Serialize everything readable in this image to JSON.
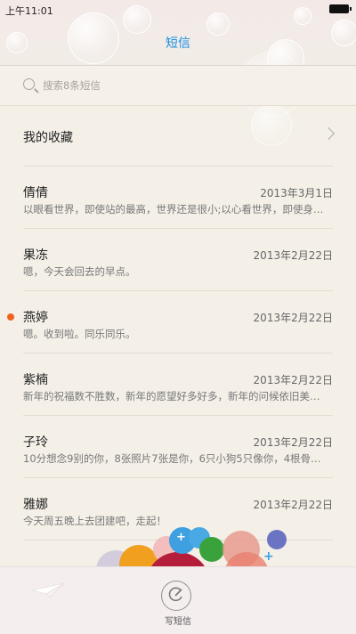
{
  "status_bar": {
    "time": "上午11:01"
  },
  "header": {
    "title": "短信"
  },
  "search": {
    "placeholder": "搜索8条短信"
  },
  "favorites": {
    "label": "我的收藏"
  },
  "conversations": [
    {
      "name": "倩倩",
      "date": "2013年3月1日",
      "preview": "以眼看世界，即使站的最高，世界还是很小;以心看世界，即使身…",
      "unread": false
    },
    {
      "name": "果冻",
      "date": "2013年2月22日",
      "preview": "嗯，今天会回去的早点。",
      "unread": false
    },
    {
      "name": "燕婷",
      "date": "2013年2月22日",
      "preview": "嗯。收到啦。同乐同乐。",
      "unread": true
    },
    {
      "name": "紫楠",
      "date": "2013年2月22日",
      "preview": "新年的祝福数不胜数，新年的愿望好多好多，新年的问候依旧美…",
      "unread": false
    },
    {
      "name": "子玲",
      "date": "2013年2月22日",
      "preview": "10分想念9别的你，8张照片7张是你，6只小狗5只像你，4根骨…",
      "unread": false
    },
    {
      "name": "雅娜",
      "date": "2013年2月22日",
      "preview": "今天周五晚上去团建吧，走起！",
      "unread": false
    }
  ],
  "bottom_bar": {
    "compose_label": "写短信"
  },
  "colors": {
    "accent": "#1a8fe3",
    "unread_dot": "#f2621f"
  }
}
